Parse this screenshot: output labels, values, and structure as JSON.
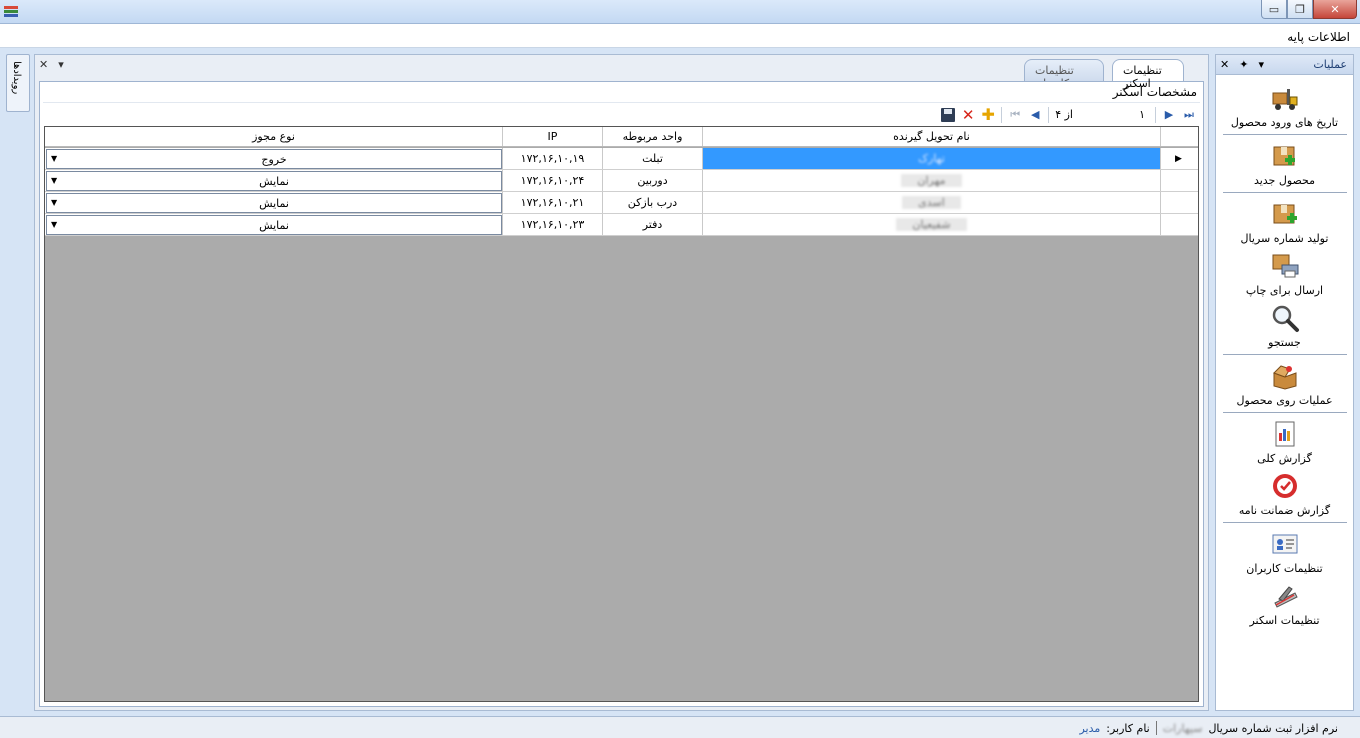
{
  "window": {
    "minimize_glyph": "▭",
    "restore_glyph": "❐",
    "close_glyph": "✕"
  },
  "menu": {
    "label": "اطلاعات پایه"
  },
  "left_dock": {
    "tab_label": "رویدادها",
    "close_glyph": "✕",
    "dropdown_glyph": "▾"
  },
  "document": {
    "tabs": [
      {
        "label": "تنظیمات اسکنر",
        "active": true
      },
      {
        "label": "تنظیمات کاربران",
        "active": false
      }
    ],
    "section_title": "مشخصات اسکنر",
    "navigator": {
      "position": "۱",
      "of_label": "از ۴",
      "first_glyph": "⏮",
      "prev_glyph": "◀",
      "next_glyph": "▶",
      "last_glyph": "⏭",
      "add_glyph": "✚",
      "delete_glyph": "✕"
    },
    "grid": {
      "columns": [
        "نام تحویل گیرنده",
        "واحد مربوطه",
        "IP",
        "نوع مجوز"
      ],
      "rows": [
        {
          "receiver": "تهارک",
          "unit": "تبلت",
          "ip": "۱۷۲,۱۶,۱۰,۱۹",
          "permit": "خروج",
          "selected": true
        },
        {
          "receiver": "مهران",
          "unit": "دوربین",
          "ip": "۱۷۲,۱۶,۱۰,۲۴",
          "permit": "نمایش",
          "selected": false
        },
        {
          "receiver": "اسدی",
          "unit": "درب بازکن",
          "ip": "۱۷۲,۱۶,۱۰,۲۱",
          "permit": "نمایش",
          "selected": false
        },
        {
          "receiver": "شفیعیان",
          "unit": "دفتر",
          "ip": "۱۷۲,۱۶,۱۰,۲۳",
          "permit": "نمایش",
          "selected": false
        }
      ],
      "row_indicator_glyph": "▶",
      "combo_arrow_glyph": "▼"
    }
  },
  "operations": {
    "title": "عملیات",
    "close_glyph": "✕",
    "pin_glyph": "✦",
    "dropdown_glyph": "▾",
    "items": [
      {
        "label": "تاریخ های ورود محصول",
        "icon": "forklift-icon"
      },
      {
        "label": "محصول جدید",
        "icon": "box-add-icon"
      },
      {
        "label": "تولید شماره سریال",
        "icon": "serial-box-icon"
      },
      {
        "label": "ارسال برای چاپ",
        "icon": "printer-icon"
      },
      {
        "label": "جستجو",
        "icon": "magnifier-icon"
      },
      {
        "label": "عملیات روی محصول",
        "icon": "open-box-icon"
      },
      {
        "label": "گزارش کلی",
        "icon": "report-icon"
      },
      {
        "label": "گزارش ضمانت نامه",
        "icon": "warranty-badge-icon"
      },
      {
        "label": "تنظیمات کاربران",
        "icon": "user-card-icon"
      },
      {
        "label": "تنظیمات اسکنر",
        "icon": "scanner-icon"
      }
    ]
  },
  "status": {
    "app_name": "نرم افزار ثبت شماره سریال",
    "company": "سپهارات",
    "user_label": "نام کاربر:",
    "user_value": "مدیر"
  },
  "colors": {
    "selection": "#3399ff",
    "grid_background": "#ababab",
    "accent": "#2a5caa"
  }
}
